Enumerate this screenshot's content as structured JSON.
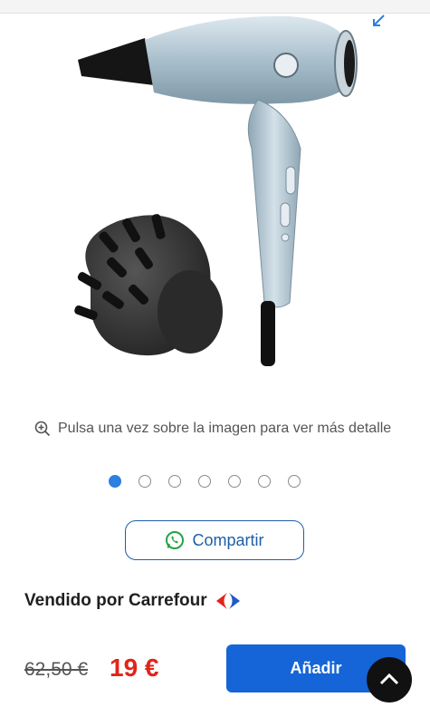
{
  "gallery": {
    "zoom_hint": "Pulsa una vez sobre la imagen para ver más detalle",
    "slides_total": 7,
    "active_slide": 1
  },
  "share": {
    "label": "Compartir"
  },
  "seller": {
    "text": "Vendido por Carrefour"
  },
  "pricing": {
    "old_price": "62,50 €",
    "price": "19 €",
    "add_label": "Añadir"
  },
  "colors": {
    "accent": "#1565d8",
    "price_red": "#e0251b",
    "share_blue": "#1d5fa7",
    "active_dot": "#2d7fe0"
  },
  "icons": {
    "expand": "expand-arrow-icon",
    "zoom": "zoom-in-icon",
    "share": "whatsapp-icon",
    "scroll_top": "chevron-up-icon"
  }
}
